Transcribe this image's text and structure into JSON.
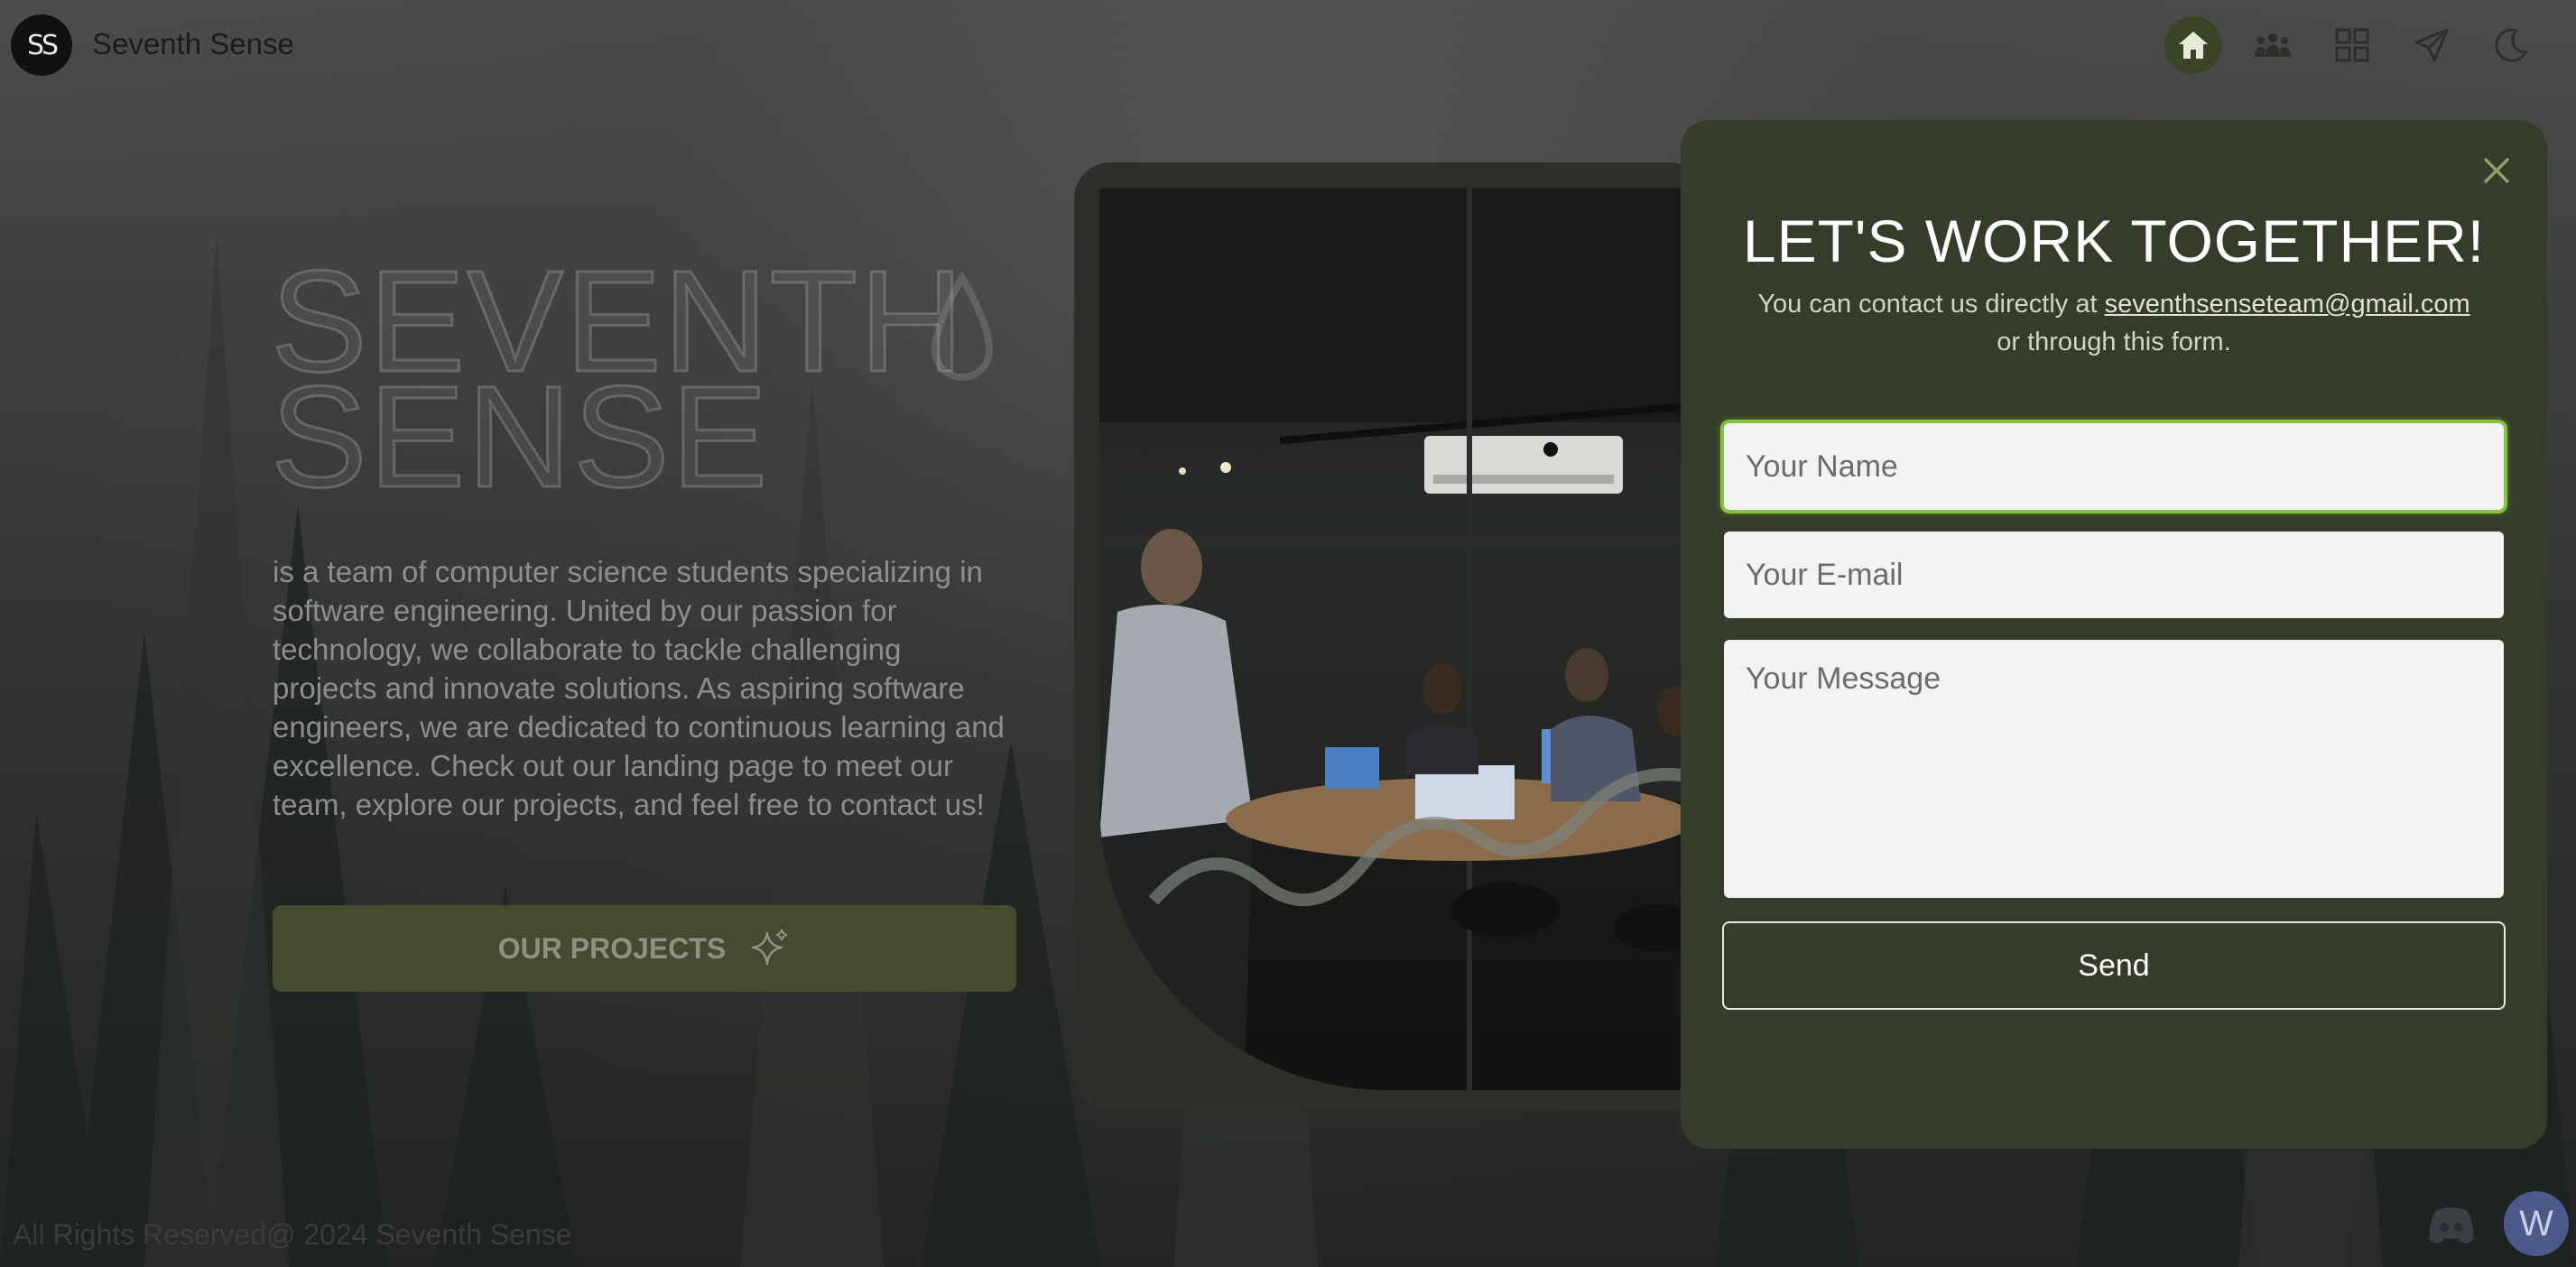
{
  "brand": {
    "logo_text": "SS",
    "name": "Seventh Sense"
  },
  "nav": {
    "items": [
      {
        "icon": "home-icon",
        "active": true
      },
      {
        "icon": "team-icon",
        "active": false
      },
      {
        "icon": "grid-icon",
        "active": false
      },
      {
        "icon": "send-icon",
        "active": false
      },
      {
        "icon": "moon-icon",
        "active": false
      }
    ]
  },
  "hero": {
    "title_line1": "SEVENTH",
    "title_line2": "SENSE",
    "description": "is a team of computer science students specializing in software engineering. United by our passion for technology, we collaborate to tackle challenging projects and innovate solutions. As aspiring software engineers, we are dedicated to continuous learning and excellence. Check out our landing page to meet our team, explore our projects, and feel free to contact us!",
    "projects_button": "OUR PROJECTS"
  },
  "contact_modal": {
    "title": "LET'S WORK TOGETHER!",
    "sub_before": "You can contact us directly at",
    "email": "seventhsenseteam@gmail.com",
    "sub_after": "or through this form.",
    "name_placeholder": "Your Name",
    "email_placeholder": "Your E-mail",
    "message_placeholder": "Your Message",
    "send_label": "Send"
  },
  "footer": {
    "copyright": "All Rights Reserved@ 2024 Seventh Sense",
    "badge_letter": "W"
  },
  "colors": {
    "modal_bg": "#353c2a",
    "accent_focus": "#86c23b",
    "active_nav": "#3c4428"
  }
}
